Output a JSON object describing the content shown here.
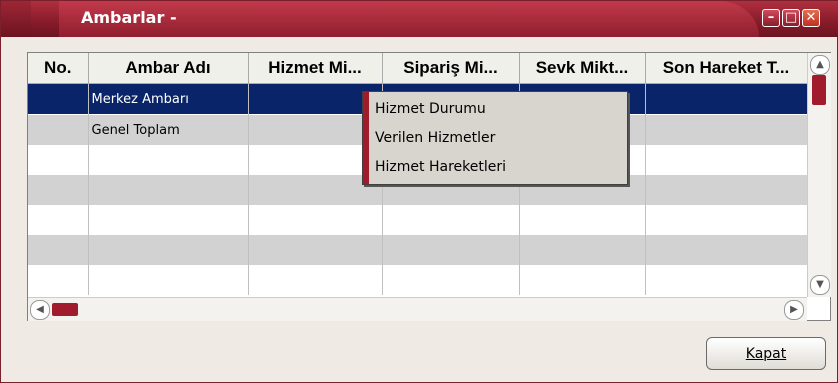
{
  "window": {
    "title": "Ambarlar -",
    "controls": [
      "minimize-icon",
      "maximize-icon",
      "close-icon"
    ]
  },
  "grid": {
    "columns": [
      "No.",
      "Ambar Adı",
      "Hizmet Mi...",
      "Sipariş  Mi...",
      "Sevk Mikt...",
      "Son Hareket T..."
    ],
    "rows": [
      {
        "no": "",
        "name": "Merkez Ambarı",
        "selected": true
      },
      {
        "no": "",
        "name": "Genel Toplam",
        "selected": false
      }
    ]
  },
  "context_menu": {
    "items": [
      "Hizmet Durumu",
      "Verilen Hizmetler",
      "Hizmet Hareketleri"
    ]
  },
  "footer": {
    "close_label": "Kapat"
  },
  "colors": {
    "accent": "#a01c2c",
    "selection": "#0a246a"
  }
}
